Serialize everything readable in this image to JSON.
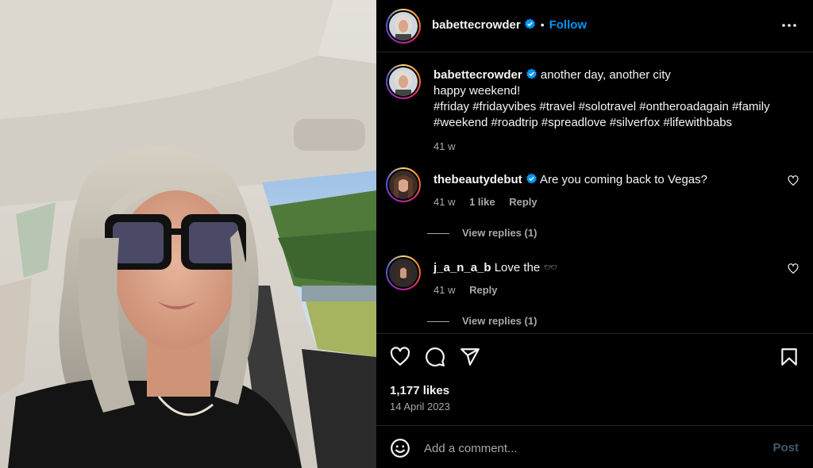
{
  "post_owner": {
    "username": "babettecrowder",
    "verified": true,
    "separator": "•",
    "follow_label": "Follow"
  },
  "caption": {
    "username": "babettecrowder",
    "line1": "another day, another city",
    "line2": "happy weekend!",
    "hashtags_line1": "#friday #fridayvibes #travel #solotravel #ontheroadagain #family",
    "hashtags_line2": "#weekend #roadtrip #spreadlove #silverfox #lifewithbabs",
    "age": "41 w"
  },
  "comments": [
    {
      "username": "thebeautydebut",
      "verified": true,
      "text": "Are you coming back to Vegas?",
      "age": "41 w",
      "likes": "1 like",
      "reply_label": "Reply",
      "view_replies": "View replies (1)"
    },
    {
      "username": "j_a_n_a_b",
      "verified": false,
      "text": "Love the 🕶️",
      "age": "41 w",
      "reply_label": "Reply",
      "view_replies": "View replies (1)"
    }
  ],
  "stats": {
    "likes": "1,177 likes",
    "date": "14 April 2023"
  },
  "add_comment": {
    "placeholder": "Add a comment...",
    "post_label": "Post"
  },
  "colors": {
    "accent_blue": "#0095f6",
    "background": "#000000",
    "muted_text": "#a8a8a8"
  },
  "icons": [
    "more-options-icon",
    "heart-icon",
    "comment-icon",
    "share-icon",
    "bookmark-icon",
    "emoji-icon",
    "verified-badge-icon",
    "small-heart-icon"
  ]
}
